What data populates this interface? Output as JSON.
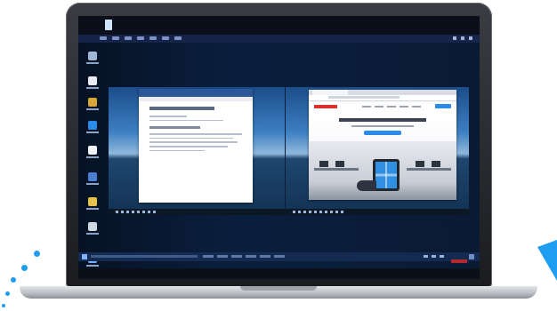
{
  "decor": {
    "accent": "#1f9df0",
    "laptop_frame": "#2b2d32",
    "desktop_bg": "#0a1f3e"
  },
  "remote_viewer": {
    "toolbar_icons": [
      "monitor-icon",
      "display-icon",
      "settings-icon",
      "keyboard-icon",
      "mouse-icon",
      "window-icon",
      "lock-icon"
    ],
    "window_controls": [
      "minimize-icon",
      "restore-icon",
      "close-icon"
    ]
  },
  "desktop": {
    "icons": [
      "recycle-bin-icon",
      "browser-icon",
      "file-icon",
      "folder-icon",
      "document-icon",
      "app-icon",
      "settings-icon",
      "app-icon",
      "user-icon"
    ]
  },
  "monitors": [
    {
      "name": "left",
      "content": "document"
    },
    {
      "name": "right",
      "content": "browser"
    }
  ],
  "brand": {
    "accent_red": "#d22a2a"
  }
}
